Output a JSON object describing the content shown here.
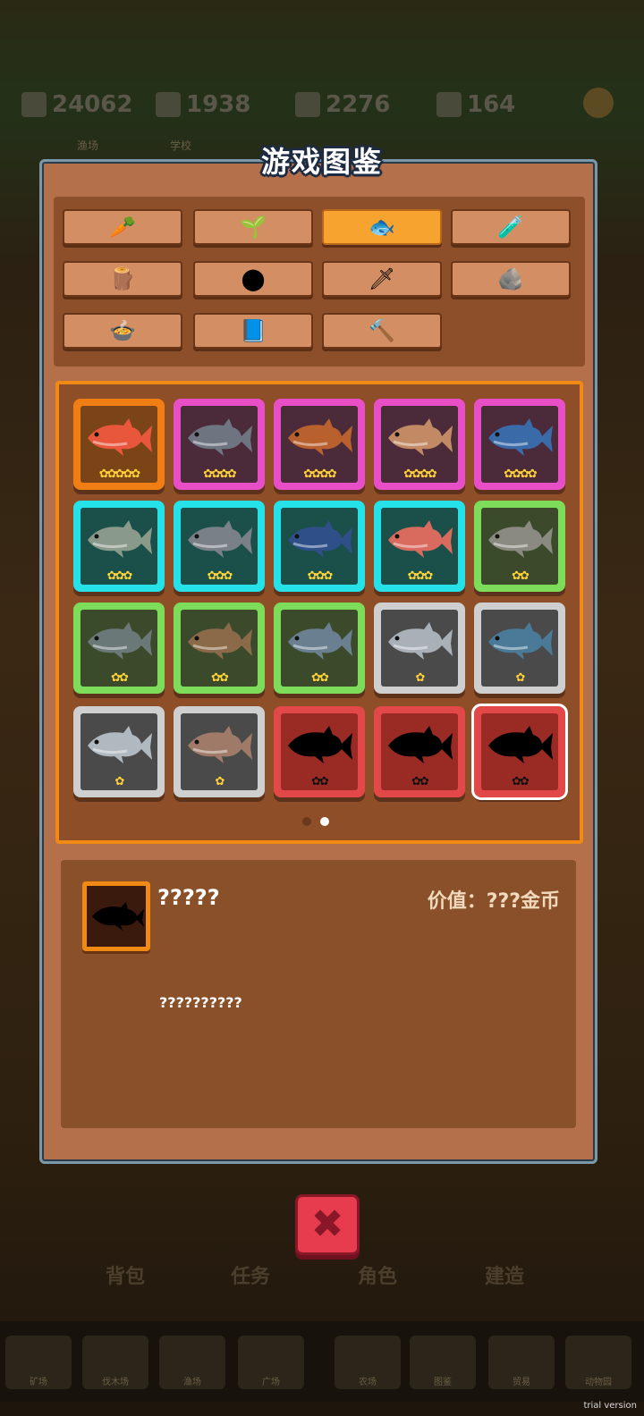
{
  "hud": {
    "gold": "24062",
    "wood": "1938",
    "clover": "2276",
    "gem": "164",
    "labels": [
      "渔场",
      "学校"
    ]
  },
  "title": "游戏图鉴",
  "categories": [
    {
      "icon": "carrot-icon",
      "glyph": "🥕",
      "active": false
    },
    {
      "icon": "seed-bag-icon",
      "glyph": "🌱",
      "active": false
    },
    {
      "icon": "fish-icon",
      "glyph": "🐟",
      "active": true
    },
    {
      "icon": "potion-icon",
      "glyph": "🧪",
      "active": false
    },
    {
      "icon": "log-icon",
      "glyph": "🪵",
      "active": false
    },
    {
      "icon": "coal-icon",
      "glyph": "⬤",
      "active": false
    },
    {
      "icon": "sword-icon",
      "glyph": "🗡",
      "active": false
    },
    {
      "icon": "rock-icon",
      "glyph": "🪨",
      "active": false
    },
    {
      "icon": "dish-icon",
      "glyph": "🍲",
      "active": false
    },
    {
      "icon": "book-icon",
      "glyph": "📘",
      "active": false
    },
    {
      "icon": "hammer-icon",
      "glyph": "🔨",
      "active": false
    }
  ],
  "fish": [
    {
      "rarity": "orange",
      "stars": "✿✿✿✿✿",
      "color": "#e8573c",
      "locked": false
    },
    {
      "rarity": "pink",
      "stars": "✿✿✿✿",
      "color": "#6e7480",
      "locked": false
    },
    {
      "rarity": "pink",
      "stars": "✿✿✿✿",
      "color": "#b8602e",
      "locked": false
    },
    {
      "rarity": "pink",
      "stars": "✿✿✿✿",
      "color": "#c28a64",
      "locked": false
    },
    {
      "rarity": "pink",
      "stars": "✿✿✿✿",
      "color": "#3a6aa8",
      "locked": false
    },
    {
      "rarity": "cyan",
      "stars": "✿✿✿",
      "color": "#8a9a8a",
      "locked": false
    },
    {
      "rarity": "cyan",
      "stars": "✿✿✿",
      "color": "#7a8088",
      "locked": false
    },
    {
      "rarity": "cyan",
      "stars": "✿✿✿",
      "color": "#2e4f88",
      "locked": false
    },
    {
      "rarity": "cyan",
      "stars": "✿✿✿",
      "color": "#d86a5e",
      "locked": false
    },
    {
      "rarity": "green",
      "stars": "✿✿",
      "color": "#8a8a80",
      "locked": false
    },
    {
      "rarity": "green",
      "stars": "✿✿",
      "color": "#6a7878",
      "locked": false
    },
    {
      "rarity": "green",
      "stars": "✿✿",
      "color": "#8a6a48",
      "locked": false
    },
    {
      "rarity": "green",
      "stars": "✿✿",
      "color": "#6a8090",
      "locked": false
    },
    {
      "rarity": "gray",
      "stars": "✿",
      "color": "#aab0b8",
      "locked": false
    },
    {
      "rarity": "gray",
      "stars": "✿",
      "color": "#4a7a98",
      "locked": false
    },
    {
      "rarity": "gray",
      "stars": "✿",
      "color": "#b0b8c0",
      "locked": false
    },
    {
      "rarity": "gray",
      "stars": "✿",
      "color": "#a07a68",
      "locked": false
    },
    {
      "rarity": "red",
      "stars": "✿✿",
      "color": "#000000",
      "locked": true
    },
    {
      "rarity": "red",
      "stars": "✿✿",
      "color": "#000000",
      "locked": true
    },
    {
      "rarity": "red",
      "stars": "✿✿",
      "color": "#000000",
      "locked": true,
      "selected": true
    }
  ],
  "pager": {
    "pages": 2,
    "current": 2
  },
  "detail": {
    "name": "?????",
    "value": "价值：???金币",
    "description": "??????????"
  },
  "bottom": {
    "tabs": [
      "背包",
      "任务",
      "角色",
      "建造"
    ],
    "nav": [
      "矿场",
      "伐木场",
      "渔场",
      "广场",
      "农场",
      "图鉴",
      "贸易",
      "动物园"
    ]
  },
  "watermark": "trial version"
}
